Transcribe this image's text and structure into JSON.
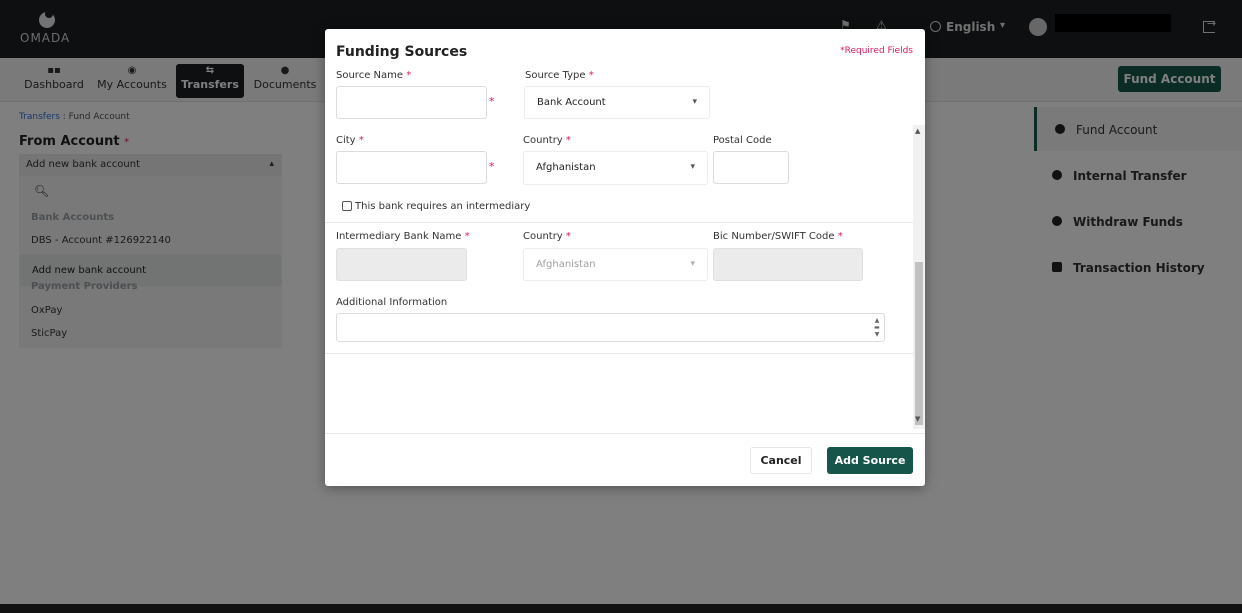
{
  "header": {
    "logo_text": "OMADA",
    "language": "English"
  },
  "nav": {
    "items": [
      {
        "label": "Dashboard",
        "icon": "grid-icon"
      },
      {
        "label": "My Accounts",
        "icon": "user-circle-icon"
      },
      {
        "label": "Transfers",
        "icon": "swap-icon"
      },
      {
        "label": "Documents",
        "icon": "document-icon"
      }
    ],
    "active": "Transfers",
    "fund_account_button": "Fund Account"
  },
  "breadcrumb": {
    "root": "Transfers",
    "separator": " : ",
    "current": "Fund Account"
  },
  "from_account": {
    "title": "From Account",
    "required_marker": "*",
    "selected": "Add new bank account",
    "options": [
      {
        "label": "Bank Accounts",
        "group": true
      },
      {
        "label": "DBS - Account #126922140"
      },
      {
        "label": "Add new bank account",
        "selected": true
      },
      {
        "label": "Payment Providers",
        "group": true
      },
      {
        "label": "OxPay"
      },
      {
        "label": "SticPay"
      }
    ]
  },
  "right_menu": {
    "items": [
      {
        "label": "Fund Account",
        "icon": "fund-icon",
        "active": true
      },
      {
        "label": "Internal Transfer",
        "icon": "transfer-icon"
      },
      {
        "label": "Withdraw Funds",
        "icon": "withdraw-icon"
      },
      {
        "label": "Transaction History",
        "icon": "history-icon"
      }
    ]
  },
  "modal": {
    "title": "Funding Sources",
    "required_note": "*Required Fields",
    "fields": {
      "source_name": {
        "label": "Source Name",
        "required": "*",
        "value": ""
      },
      "source_type": {
        "label": "Source Type",
        "required": "*",
        "value": "Bank Account"
      },
      "city": {
        "label": "City",
        "required": "*",
        "value": ""
      },
      "country": {
        "label": "Country",
        "required": "*",
        "value": "Afghanistan"
      },
      "postal_code": {
        "label": "Postal Code",
        "value": ""
      },
      "intermediary_checkbox": {
        "label": "This bank requires an intermediary",
        "checked": false
      },
      "intermediary_bank_name": {
        "label": "Intermediary Bank Name",
        "required": "*",
        "value": ""
      },
      "intermediary_country": {
        "label": "Country",
        "required": "*",
        "value": "Afghanistan"
      },
      "bic_swift": {
        "label": "Bic Number/SWIFT Code",
        "required": "*",
        "value": ""
      },
      "additional_info": {
        "label": "Additional Information",
        "value": ""
      }
    },
    "buttons": {
      "cancel": "Cancel",
      "add": "Add Source"
    }
  },
  "colors": {
    "primary": "#16564a",
    "required": "#d81b60",
    "header_bg": "#1c1f21"
  }
}
